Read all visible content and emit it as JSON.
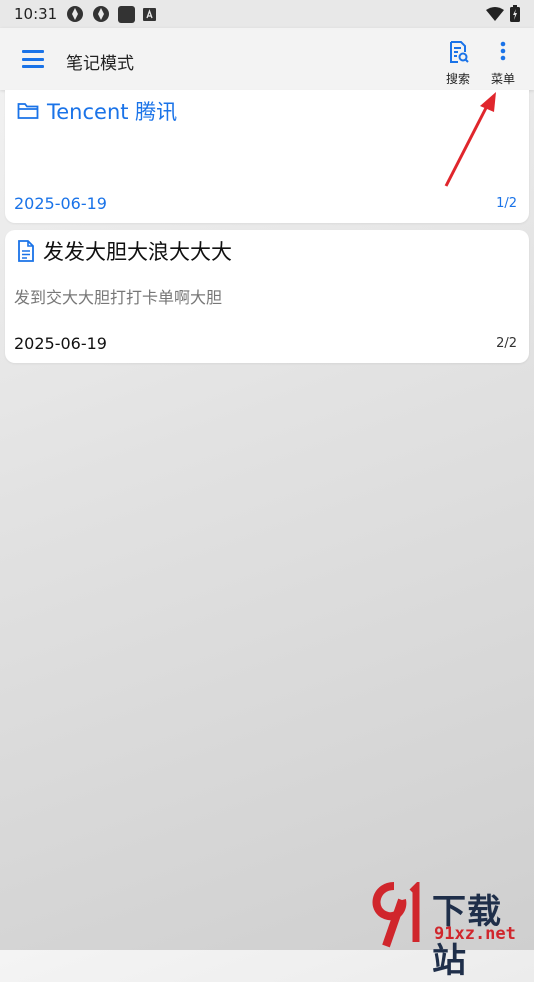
{
  "status_bar": {
    "time": "10:31"
  },
  "app_bar": {
    "title": "笔记模式",
    "search_label": "搜索",
    "menu_label": "菜单"
  },
  "notes": [
    {
      "type": "folder",
      "title": "Tencent 腾讯",
      "body": "",
      "date": "2025-06-19",
      "page": "1/2"
    },
    {
      "type": "note",
      "title": "发发大胆大浪大大大",
      "body": "发到交大大胆打打卡单啊大胆",
      "date": "2025-06-19",
      "page": "2/2"
    }
  ],
  "colors": {
    "accent": "#1a73e8",
    "annotation_arrow": "#e0262c"
  },
  "watermark": {
    "brand": "下载站",
    "url": "91xz.net"
  }
}
